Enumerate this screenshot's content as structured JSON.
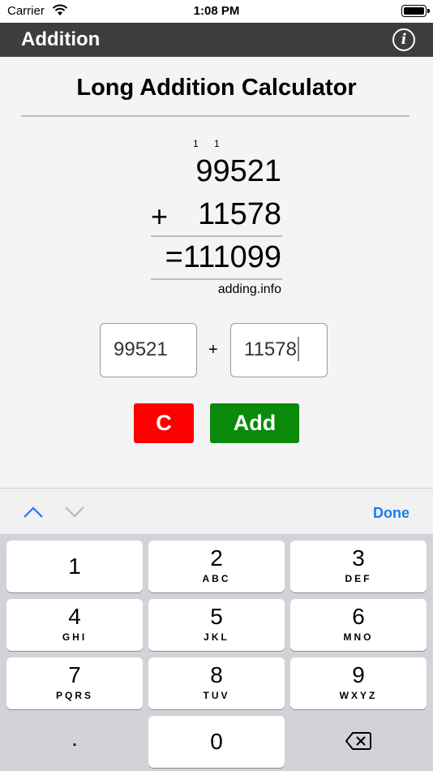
{
  "status_bar": {
    "carrier": "Carrier",
    "time": "1:08 PM"
  },
  "nav": {
    "title": "Addition",
    "info_glyph": "i"
  },
  "main": {
    "heading": "Long Addition Calculator",
    "carries": [
      "1",
      "1"
    ],
    "operand_1": "99521",
    "plus": "+",
    "operand_2": "11578",
    "result": "=111099",
    "credit": "adding.info",
    "input_1_value": "99521",
    "input_plus": "+",
    "input_2_value": "11578",
    "clear_label": "C",
    "add_label": "Add"
  },
  "keyboard_toolbar": {
    "done_label": "Done"
  },
  "keypad": {
    "keys": [
      {
        "digit": "1",
        "letters": ""
      },
      {
        "digit": "2",
        "letters": "ABC"
      },
      {
        "digit": "3",
        "letters": "DEF"
      },
      {
        "digit": "4",
        "letters": "GHI"
      },
      {
        "digit": "5",
        "letters": "JKL"
      },
      {
        "digit": "6",
        "letters": "MNO"
      },
      {
        "digit": "7",
        "letters": "PQRS"
      },
      {
        "digit": "8",
        "letters": "TUV"
      },
      {
        "digit": "9",
        "letters": "WXYZ"
      }
    ],
    "decimal": ".",
    "zero": "0"
  },
  "colors": {
    "nav_background": "#3d3d3d",
    "clear_button": "#ff0000",
    "add_button": "#0a8a0a",
    "accent": "#1a7cf0"
  },
  "icons": [
    "wifi-icon",
    "battery-icon",
    "info-icon",
    "chevron-up-icon",
    "chevron-down-icon",
    "backspace-icon"
  ]
}
